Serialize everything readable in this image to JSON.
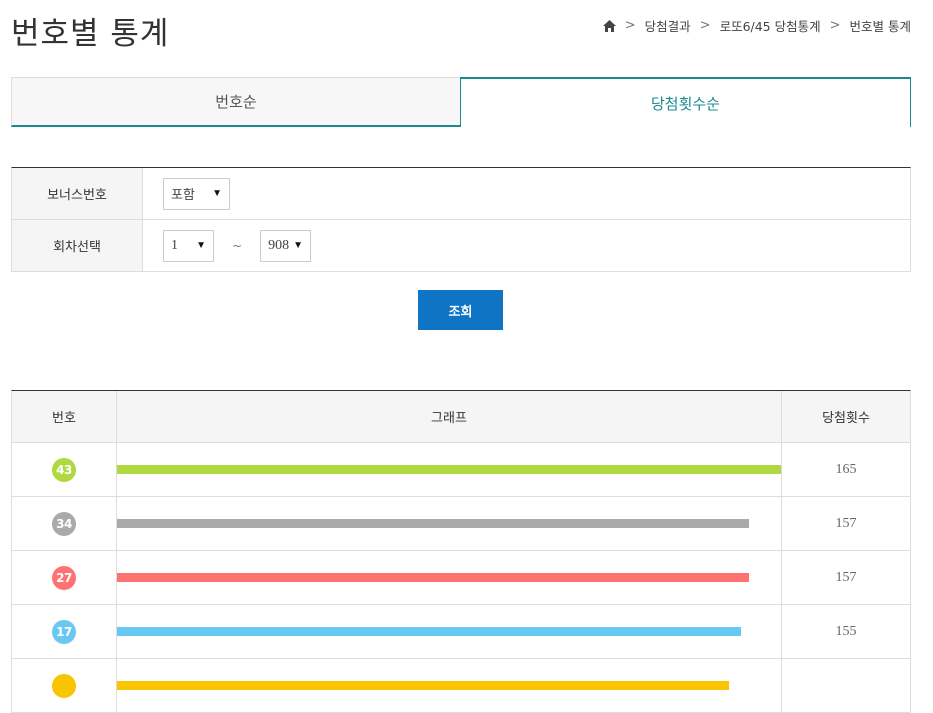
{
  "header": {
    "title": "번호별 통계",
    "breadcrumb": [
      "당첨결과",
      "로또6/45 당첨통계",
      "번호별 통계"
    ]
  },
  "tabs": [
    {
      "label": "번호순",
      "active": false
    },
    {
      "label": "당첨횟수순",
      "active": true
    }
  ],
  "filter": {
    "bonus_label": "보너스번호",
    "bonus_value": "포함",
    "round_label": "회차선택",
    "round_from": "1",
    "tilde": "~",
    "round_to": "908"
  },
  "search_button": "조회",
  "table": {
    "headers": [
      "번호",
      "그래프",
      "당첨횟수"
    ],
    "max_count": 165,
    "rows": [
      {
        "number": "43",
        "count": "165",
        "color": "#b0d840"
      },
      {
        "number": "34",
        "count": "157",
        "color": "#aaaaaa"
      },
      {
        "number": "27",
        "count": "157",
        "color": "#ff7272"
      },
      {
        "number": "17",
        "count": "155",
        "color": "#69c8f2"
      },
      {
        "number": "",
        "count": "",
        "color": "#fbc400",
        "bar_value": 152
      }
    ]
  },
  "colors": {
    "accent": "#1a8a8f",
    "button": "#0f74c4"
  }
}
